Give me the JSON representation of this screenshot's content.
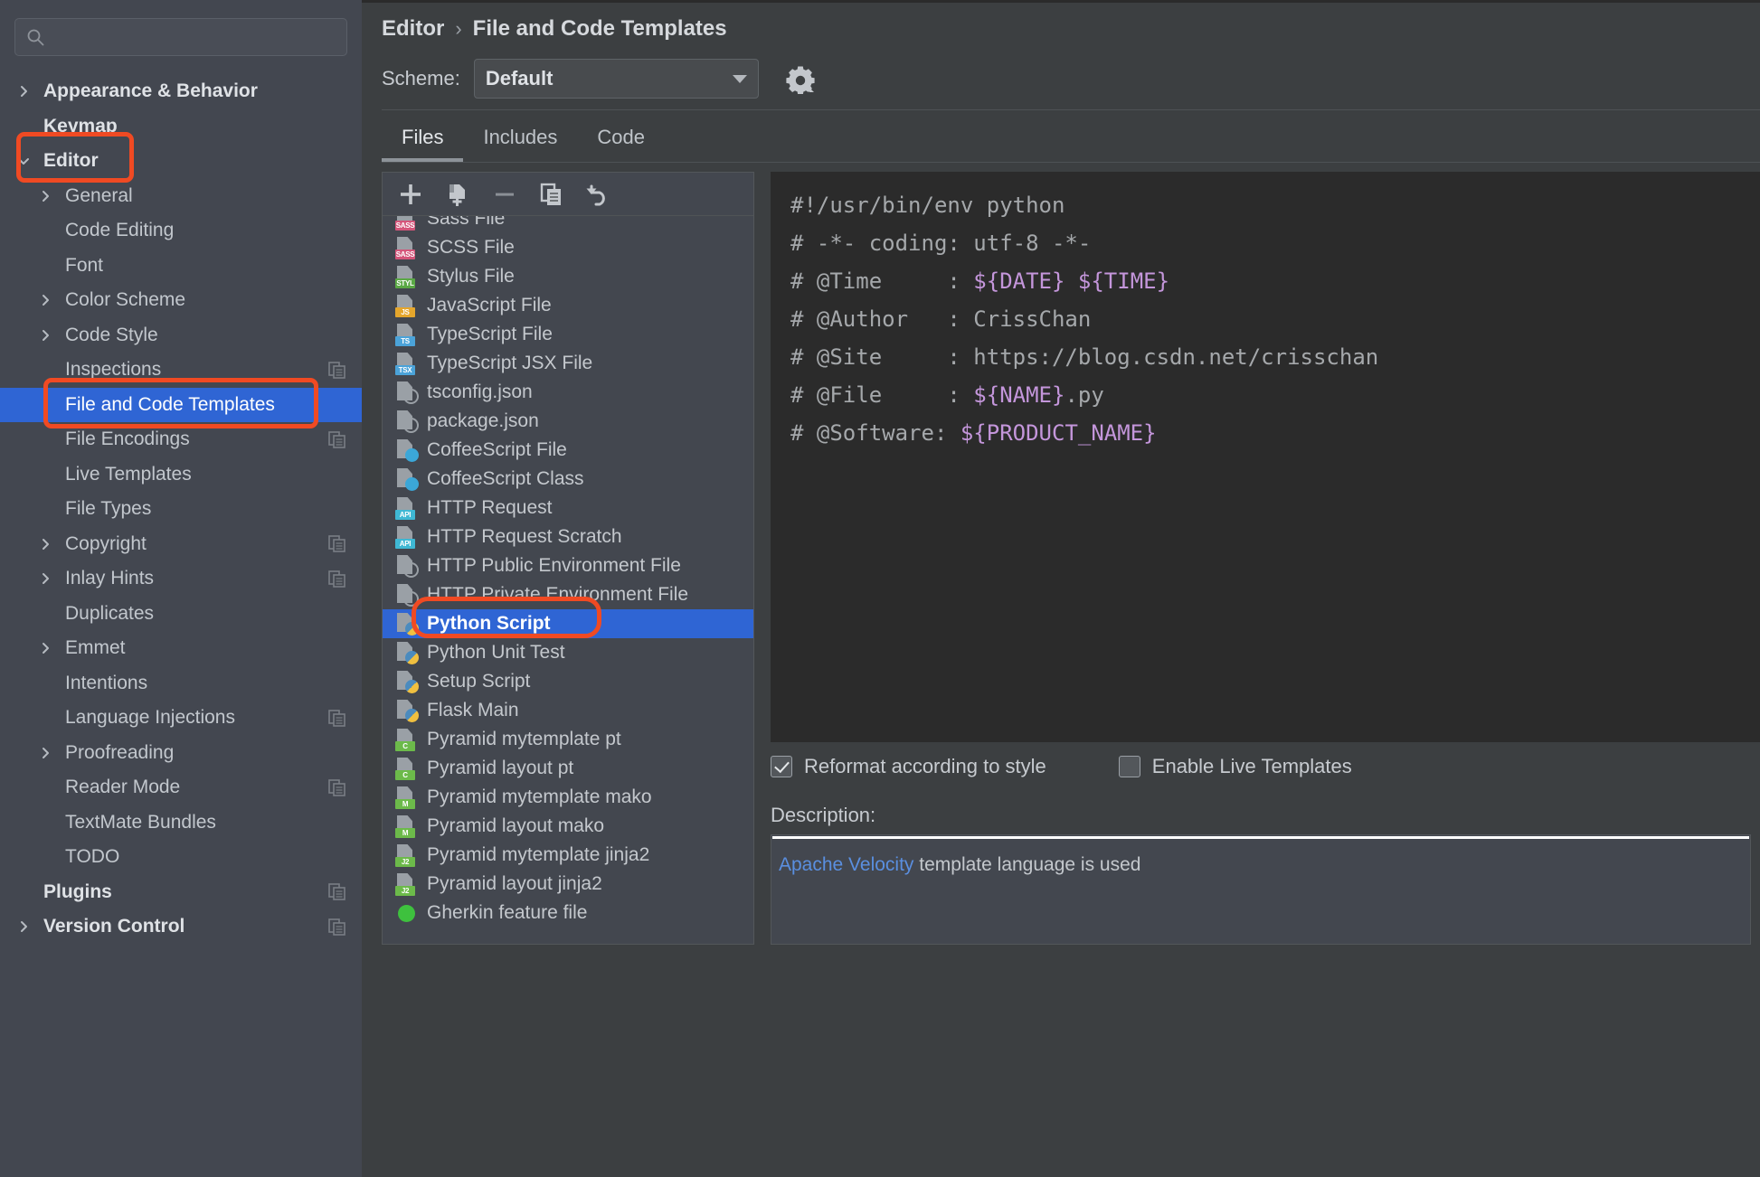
{
  "search": {
    "placeholder": "",
    "value": "",
    "icon": "search-icon"
  },
  "sidebar": {
    "items": [
      {
        "label": "Appearance & Behavior",
        "arrow": "right",
        "bold": true,
        "indent": 48,
        "copy": false
      },
      {
        "label": "Keymap",
        "arrow": "none",
        "bold": true,
        "indent": 48,
        "copy": false
      },
      {
        "label": "Editor",
        "arrow": "down",
        "bold": true,
        "indent": 48,
        "copy": false
      },
      {
        "label": "General",
        "arrow": "right",
        "bold": false,
        "indent": 72,
        "copy": false
      },
      {
        "label": "Code Editing",
        "arrow": "none",
        "bold": false,
        "indent": 72,
        "copy": false
      },
      {
        "label": "Font",
        "arrow": "none",
        "bold": false,
        "indent": 72,
        "copy": false
      },
      {
        "label": "Color Scheme",
        "arrow": "right",
        "bold": false,
        "indent": 72,
        "copy": false
      },
      {
        "label": "Code Style",
        "arrow": "right",
        "bold": false,
        "indent": 72,
        "copy": false
      },
      {
        "label": "Inspections",
        "arrow": "none",
        "bold": false,
        "indent": 72,
        "copy": true
      },
      {
        "label": "File and Code Templates",
        "arrow": "none",
        "bold": false,
        "indent": 72,
        "copy": false,
        "selected": true
      },
      {
        "label": "File Encodings",
        "arrow": "none",
        "bold": false,
        "indent": 72,
        "copy": true
      },
      {
        "label": "Live Templates",
        "arrow": "none",
        "bold": false,
        "indent": 72,
        "copy": false
      },
      {
        "label": "File Types",
        "arrow": "none",
        "bold": false,
        "indent": 72,
        "copy": false
      },
      {
        "label": "Copyright",
        "arrow": "right",
        "bold": false,
        "indent": 72,
        "copy": true
      },
      {
        "label": "Inlay Hints",
        "arrow": "right",
        "bold": false,
        "indent": 72,
        "copy": true
      },
      {
        "label": "Duplicates",
        "arrow": "none",
        "bold": false,
        "indent": 72,
        "copy": false
      },
      {
        "label": "Emmet",
        "arrow": "right",
        "bold": false,
        "indent": 72,
        "copy": false
      },
      {
        "label": "Intentions",
        "arrow": "none",
        "bold": false,
        "indent": 72,
        "copy": false
      },
      {
        "label": "Language Injections",
        "arrow": "none",
        "bold": false,
        "indent": 72,
        "copy": true
      },
      {
        "label": "Proofreading",
        "arrow": "right",
        "bold": false,
        "indent": 72,
        "copy": false
      },
      {
        "label": "Reader Mode",
        "arrow": "none",
        "bold": false,
        "indent": 72,
        "copy": true
      },
      {
        "label": "TextMate Bundles",
        "arrow": "none",
        "bold": false,
        "indent": 72,
        "copy": false
      },
      {
        "label": "TODO",
        "arrow": "none",
        "bold": false,
        "indent": 72,
        "copy": false
      },
      {
        "label": "Plugins",
        "arrow": "none",
        "bold": true,
        "indent": 48,
        "copy": true
      },
      {
        "label": "Version Control",
        "arrow": "right",
        "bold": true,
        "indent": 48,
        "copy": true
      }
    ]
  },
  "breadcrumb": {
    "parent": "Editor",
    "separator": "›",
    "current": "File and Code Templates"
  },
  "scheme": {
    "label": "Scheme:",
    "value": "Default",
    "options": [
      "Default"
    ],
    "gear_icon": "gear-icon",
    "caret_icon": "chevron-down-icon"
  },
  "tabs": [
    {
      "label": "Files",
      "active": true
    },
    {
      "label": "Includes",
      "active": false
    },
    {
      "label": "Code",
      "active": false
    }
  ],
  "list_toolbar": [
    {
      "name": "add-template-button",
      "icon": "plus-icon"
    },
    {
      "name": "create-child-template-button",
      "icon": "add-document-icon"
    },
    {
      "name": "remove-template-button",
      "icon": "minus-icon"
    },
    {
      "name": "copy-template-button",
      "icon": "copy-icon"
    },
    {
      "name": "reset-template-button",
      "icon": "undo-icon"
    }
  ],
  "file_list": [
    {
      "label": "Sass File",
      "icon": "sass-file-icon",
      "badge": "SASS",
      "badge_color": "#d4557a",
      "partial": true
    },
    {
      "label": "SCSS File",
      "icon": "scss-file-icon",
      "badge": "SASS",
      "badge_color": "#d4557a"
    },
    {
      "label": "Stylus File",
      "icon": "stylus-file-icon",
      "badge": "STYL",
      "badge_color": "#5aa845"
    },
    {
      "label": "JavaScript File",
      "icon": "javascript-file-icon",
      "badge": "JS",
      "badge_color": "#e5a62c"
    },
    {
      "label": "TypeScript File",
      "icon": "typescript-file-icon",
      "badge": "TS",
      "badge_color": "#4ba3d9"
    },
    {
      "label": "TypeScript JSX File",
      "icon": "typescript-jsx-file-icon",
      "badge": "TSX",
      "badge_color": "#4ba3d9"
    },
    {
      "label": "tsconfig.json",
      "icon": "json-file-icon",
      "badge": "",
      "badge_color": ""
    },
    {
      "label": "package.json",
      "icon": "json-file-icon",
      "badge": "",
      "badge_color": ""
    },
    {
      "label": "CoffeeScript File",
      "icon": "coffeescript-file-icon",
      "badge": "",
      "badge_color": "#3ba7d8"
    },
    {
      "label": "CoffeeScript Class",
      "icon": "coffeescript-file-icon",
      "badge": "",
      "badge_color": "#3ba7d8"
    },
    {
      "label": "HTTP Request",
      "icon": "http-request-icon",
      "badge": "API",
      "badge_color": "#3fb8d4"
    },
    {
      "label": "HTTP Request Scratch",
      "icon": "http-request-icon",
      "badge": "API",
      "badge_color": "#3fb8d4"
    },
    {
      "label": "HTTP Public Environment File",
      "icon": "json-file-icon",
      "badge": "",
      "badge_color": ""
    },
    {
      "label": "HTTP Private Environment File",
      "icon": "json-file-icon",
      "badge": "",
      "badge_color": ""
    },
    {
      "label": "Python Script",
      "icon": "python-file-icon",
      "badge": "",
      "badge_color": "#f0c040",
      "selected": true
    },
    {
      "label": "Python Unit Test",
      "icon": "python-file-icon",
      "badge": "",
      "badge_color": "#f0c040"
    },
    {
      "label": "Setup Script",
      "icon": "python-file-icon",
      "badge": "",
      "badge_color": "#f0c040"
    },
    {
      "label": "Flask Main",
      "icon": "python-file-icon",
      "badge": "",
      "badge_color": "#f0c040"
    },
    {
      "label": "Pyramid mytemplate pt",
      "icon": "chameleon-file-icon",
      "badge": "C",
      "badge_color": "#6cba4a"
    },
    {
      "label": "Pyramid layout pt",
      "icon": "chameleon-file-icon",
      "badge": "C",
      "badge_color": "#6cba4a"
    },
    {
      "label": "Pyramid mytemplate mako",
      "icon": "mako-file-icon",
      "badge": "M",
      "badge_color": "#6cba4a"
    },
    {
      "label": "Pyramid layout mako",
      "icon": "mako-file-icon",
      "badge": "M",
      "badge_color": "#6cba4a"
    },
    {
      "label": "Pyramid mytemplate jinja2",
      "icon": "jinja-file-icon",
      "badge": "J2",
      "badge_color": "#6cba4a"
    },
    {
      "label": "Pyramid layout jinja2",
      "icon": "jinja-file-icon",
      "badge": "J2",
      "badge_color": "#6cba4a"
    },
    {
      "label": "Gherkin feature file",
      "icon": "gherkin-file-icon",
      "badge": "",
      "badge_color": "#3ec13e"
    }
  ],
  "editor": {
    "lines": [
      [
        {
          "t": "#!/usr/bin/env python",
          "c": "txt"
        }
      ],
      [
        {
          "t": "# -*- coding: utf-8 -*-",
          "c": "txt"
        }
      ],
      [
        {
          "t": "# @Time     : ",
          "c": "txt"
        },
        {
          "t": "${DATE} ${TIME}",
          "c": "var"
        }
      ],
      [
        {
          "t": "# @Author   : CrissChan",
          "c": "txt"
        }
      ],
      [
        {
          "t": "# @Site     : https://blog.csdn.net/crisschan",
          "c": "txt"
        }
      ],
      [
        {
          "t": "# @File     : ",
          "c": "txt"
        },
        {
          "t": "${NAME}",
          "c": "var"
        },
        {
          "t": ".py",
          "c": "txt"
        }
      ],
      [
        {
          "t": "# @Software: ",
          "c": "txt"
        },
        {
          "t": "${PRODUCT_NAME}",
          "c": "var"
        }
      ]
    ]
  },
  "options": {
    "reformat": {
      "label": "Reformat according to style",
      "checked": true
    },
    "live_templates": {
      "label": "Enable Live Templates",
      "checked": false
    }
  },
  "description": {
    "label": "Description:",
    "link_text": "Apache Velocity",
    "rest_text": " template language is used"
  },
  "colors": {
    "selection_blue": "#2f65d4",
    "annotation_red": "#f04a23",
    "sidebar_bg": "#434750",
    "panel_bg": "#3c3f41",
    "editor_bg": "#2b2b2b",
    "link_blue": "#5a8fe0",
    "template_var": "#c496db"
  }
}
